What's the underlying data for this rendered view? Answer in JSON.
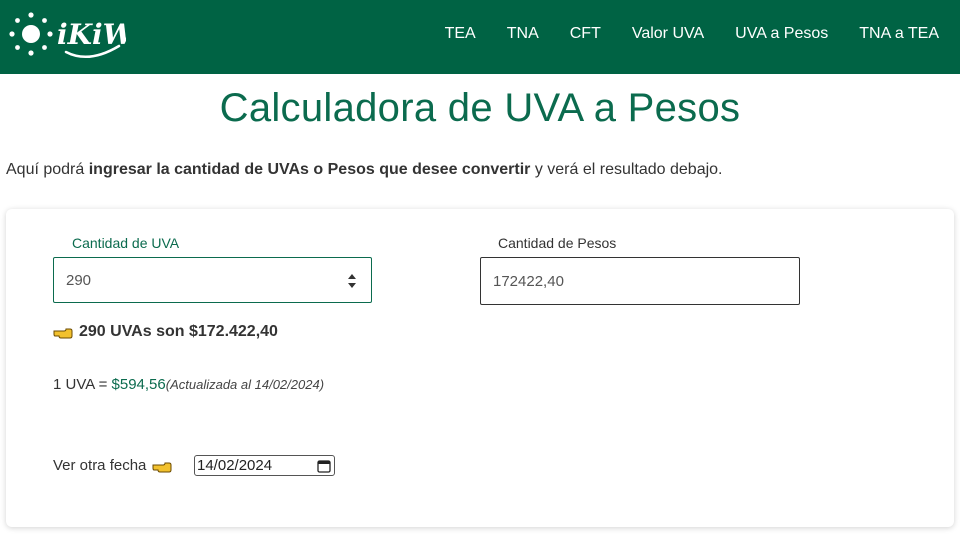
{
  "brand": {
    "name": "iKiWi"
  },
  "nav": {
    "items": [
      {
        "label": "TEA"
      },
      {
        "label": "TNA"
      },
      {
        "label": "CFT"
      },
      {
        "label": "Valor UVA"
      },
      {
        "label": "UVA a Pesos"
      },
      {
        "label": "TNA a TEA"
      }
    ]
  },
  "page": {
    "title": "Calculadora de UVA a Pesos",
    "intro_prefix": "Aquí podrá ",
    "intro_bold": "ingresar la cantidad de UVAs o Pesos que desee convertir",
    "intro_suffix": " y verá el resultado debajo."
  },
  "form": {
    "uva_label": "Cantidad de UVA",
    "uva_value": "290",
    "pesos_label": "Cantidad de Pesos",
    "pesos_value": "172422,40"
  },
  "result": {
    "text": "290 UVAs son $172.422,40"
  },
  "rate": {
    "prefix": "1 UVA = ",
    "value": "$594,56",
    "note": "(Actualizada al 14/02/2024)"
  },
  "date_picker": {
    "label": "Ver otra fecha",
    "value": "14/02/2024"
  },
  "colors": {
    "header_bg": "#006344",
    "accent": "#0b6b4e",
    "hand_icon": "#f2c12e"
  }
}
